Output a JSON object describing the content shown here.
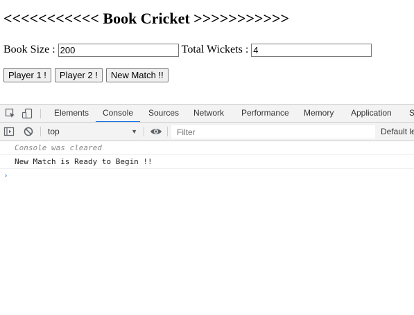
{
  "page": {
    "title": "<<<<<<<<<<< Book Cricket >>>>>>>>>>>"
  },
  "form": {
    "book_size_label": "Book Size :",
    "book_size_value": "200",
    "total_wickets_label": "Total Wickets :",
    "total_wickets_value": "4"
  },
  "buttons": {
    "player1": "Player 1 !",
    "player2": "Player 2 !",
    "new_match": "New Match !!"
  },
  "devtools": {
    "tabs": [
      "Elements",
      "Console",
      "Sources",
      "Network",
      "Performance",
      "Memory",
      "Application",
      "S"
    ],
    "active_tab": "Console",
    "context": "top",
    "filter_placeholder": "Filter",
    "levels_label": "Default le",
    "console_messages": [
      {
        "type": "cleared",
        "text": "Console was cleared"
      },
      {
        "type": "log",
        "text": "New Match is Ready to Begin !!"
      }
    ],
    "prompt_symbol": "›",
    "icons": {
      "inspect": "inspect-element-icon",
      "device": "device-toolbar-icon",
      "sidebar": "show-sidebar-icon",
      "clear": "clear-console-icon",
      "eye": "live-expression-eye-icon"
    },
    "accent_color": "#1a73e8"
  }
}
